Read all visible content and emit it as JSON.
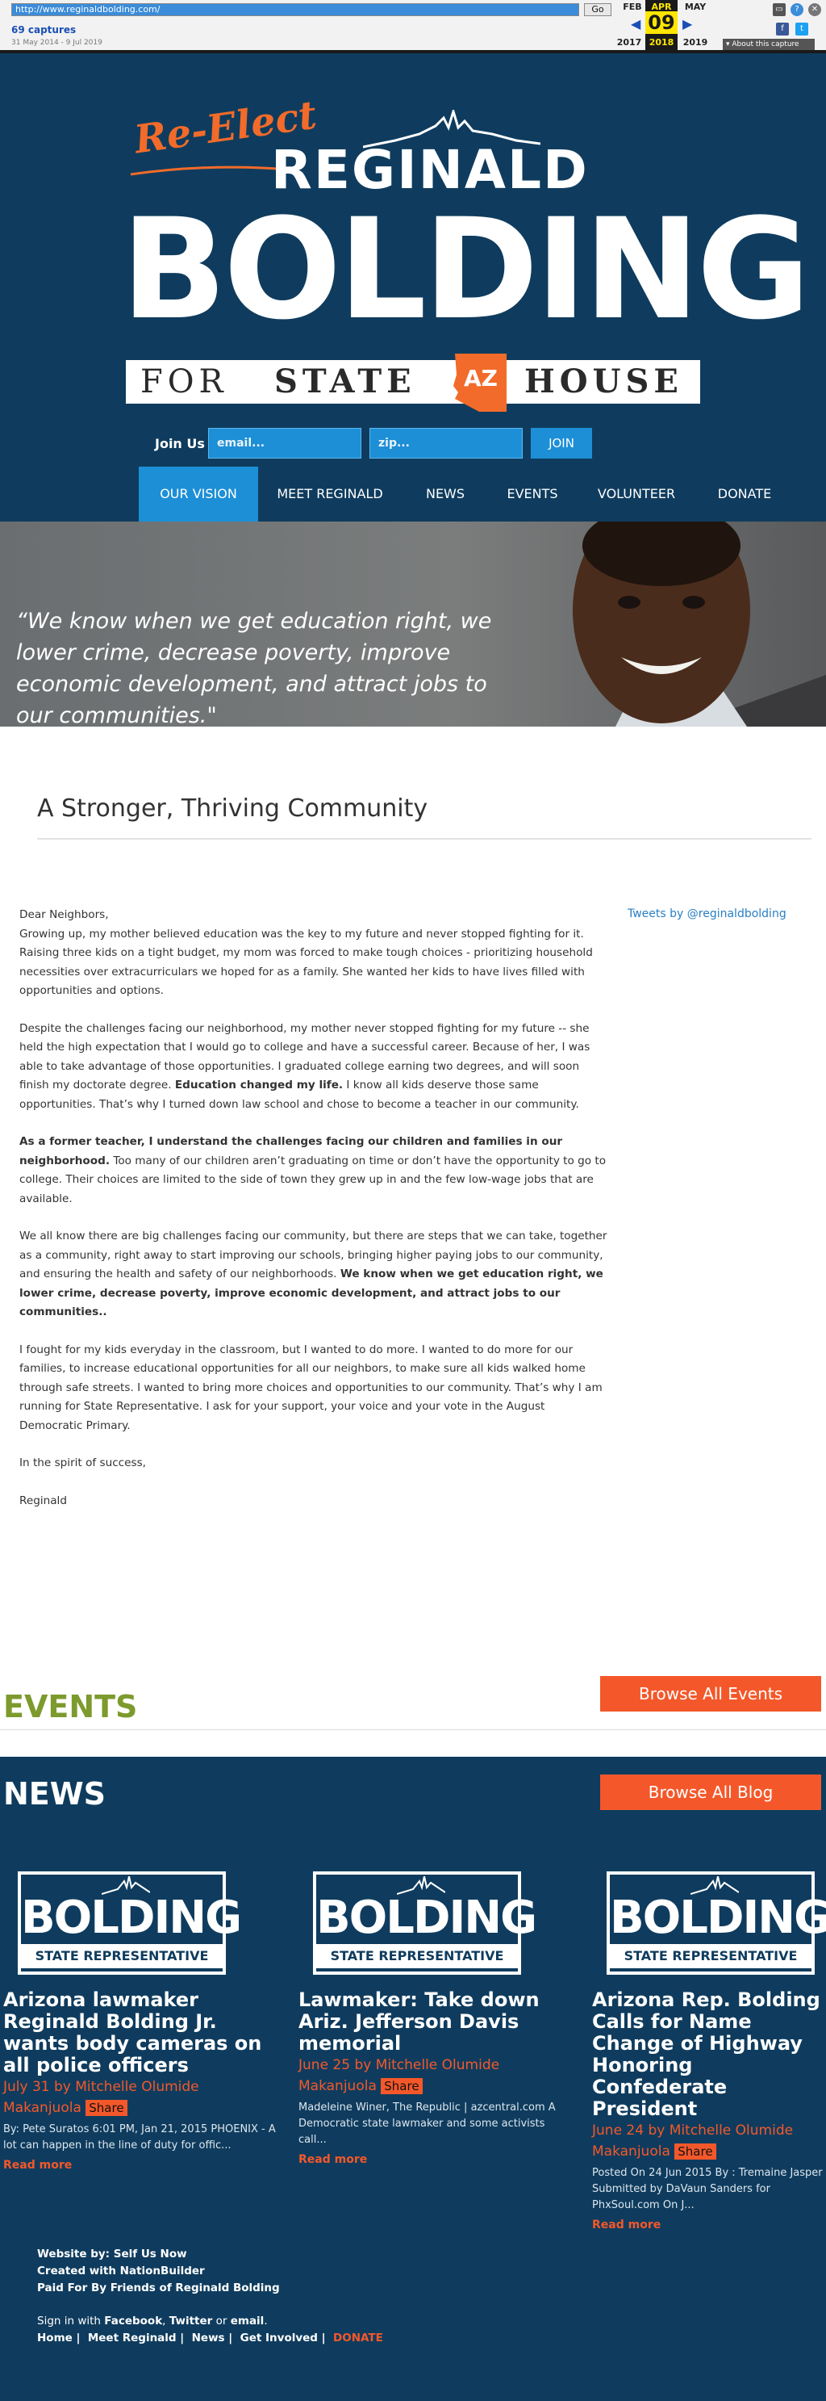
{
  "wayback": {
    "url": "http://www.reginaldbolding.com/",
    "go": "Go",
    "captures": "69 captures",
    "range": "31 May 2014 - 9 Jul 2019",
    "prev_month": "FEB",
    "cur_month": "APR",
    "next_month": "MAY",
    "prev_year": "2017",
    "cur_day": "09",
    "cur_year": "2018",
    "next_year": "2019",
    "about": "▾ About this capture"
  },
  "logo": {
    "reelect": "Re-Elect",
    "first": "REGINALD",
    "last": "BOLDING",
    "for": "FOR",
    "state": "STATE",
    "az": "AZ",
    "house": "HOUSE"
  },
  "join": {
    "label": "Join Us",
    "email_placeholder": "email...",
    "zip_placeholder": "zip...",
    "button": "JOIN"
  },
  "nav": [
    "OUR VISION",
    "MEET REGINALD",
    "NEWS",
    "EVENTS",
    "VOLUNTEER",
    "DONATE"
  ],
  "hero": {
    "quote": "“We know when we get education right, we lower crime, decrease poverty, improve economic development, and attract jobs to our communities.\""
  },
  "main": {
    "title": "A Stronger, Thriving Community",
    "tweets": "Tweets by @reginaldbolding",
    "greeting": "Dear Neighbors,",
    "p1": "Growing up, my mother believed education was the key to my future and never stopped fighting for it. Raising three kids on a tight budget, my mom was forced to make tough choices - prioritizing household necessities over extracurriculars we hoped for as a family. She wanted her kids to have lives filled with opportunities and options.",
    "p2a": "Despite the challenges facing our neighborhood, my mother never stopped fighting for my future -- she held the high expectation that I would go to college and have a successful career. Because of her, I was able to take advantage of those opportunities.  I graduated college earning two degrees, and will soon finish my doctorate degree. ",
    "p2b": "Education changed my life.",
    "p2c": " I know all kids deserve those same opportunities. That’s why I turned down law school and chose to become a teacher in our community.",
    "p3a": "As a former teacher, I understand the challenges facing our children and families in our neighborhood.",
    "p3b": " Too many of our children aren’t graduating on time or don’t have the opportunity to go to college. Their choices are limited to the side of town they grew up in and the few low-wage jobs that are available.",
    "p4a": "We all know there are big challenges facing our community, but there are steps that we can take, together as a community, right away to start improving our schools, bringing higher paying jobs to our community, and ensuring the health and safety of our neighborhoods. ",
    "p4b": "We know when we get education right, we lower crime, decrease poverty, improve economic development, and attract jobs to our communities..",
    "p5": "I fought for my kids everyday in the classroom, but I wanted to do more. I wanted to do more for our families, to increase educational opportunities for all our neighbors, to make sure all kids walked home through safe streets. I wanted to bring more choices and opportunities to our community. That’s why I am running for State Representative. I ask for your support, your voice and your vote in the August Democratic Primary.",
    "closing": "In the spirit of success,",
    "signature": "Reginald"
  },
  "events": {
    "title": "EVENTS",
    "button": "Browse All Events"
  },
  "news": {
    "title": "NEWS",
    "button": "Browse All Blog",
    "thumb_name": "BOLDING",
    "thumb_sub": "STATE REPRESENTATIVE",
    "share": "Share",
    "read_more": "Read more",
    "cards": [
      {
        "title": "Arizona lawmaker Reginald Bolding Jr. wants body cameras on all police officers",
        "meta": "July 31 by Mitchelle Olumide",
        "author": "Makanjuola",
        "body": "By: Pete Suratos 6:01 PM, Jan 21, 2015 PHOENIX - A lot can happen in the line of duty for offic..."
      },
      {
        "title": "Lawmaker: Take down Ariz. Jefferson Davis memorial",
        "meta": "June 25 by Mitchelle Olumide",
        "author": "Makanjuola",
        "body": "Madeleine Winer, The Republic | azcentral.com A Democratic state lawmaker and some activists call..."
      },
      {
        "title": "Arizona Rep. Bolding Calls for Name Change of Highway Honoring Confederate President",
        "meta": "June 24 by Mitchelle Olumide",
        "author": "Makanjuola",
        "body": "Posted On 24 Jun 2015 By : Tremaine Jasper Submitted by DaVaun Sanders for PhxSoul.com On J..."
      }
    ]
  },
  "footer": {
    "website_by": "Website by: Self Us Now",
    "created": "Created with NationBuilder",
    "paid": "Paid For By Friends of Reginald Bolding",
    "sign_prefix": "Sign in with ",
    "facebook": "Facebook",
    "comma": ", ",
    "twitter": "Twitter",
    "or": " or ",
    "email": "email",
    "dot": ".",
    "links": [
      "Home",
      "Meet Reginald",
      "News",
      "Get Involved",
      "DONATE"
    ]
  },
  "colors": {
    "navy": "#0f3c5e",
    "blue": "#1d8fd6",
    "orange": "#f4582a",
    "green": "#7d9a2d"
  }
}
